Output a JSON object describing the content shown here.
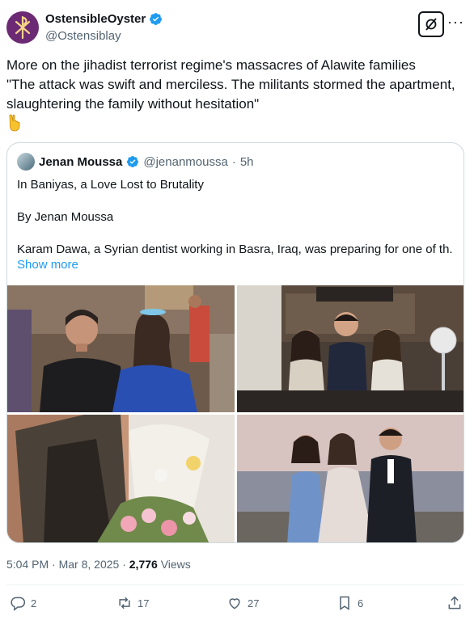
{
  "author": {
    "display_name": "OstensibleOyster",
    "handle": "@Ostensiblay",
    "avatar_icon": "chi-rho-icon",
    "avatar_color": "#6b2a73"
  },
  "post": {
    "text": "More on the jihadist terrorist regime's massacres of Alawite families\n\"The attack was swift and merciless. The militants stormed the apartment, slaughtering the family without hesitation\"",
    "emoji_icon": "pointing-down-icon",
    "time": "5:04 PM",
    "separator": "·",
    "date": "Mar 8, 2025",
    "views_count": "2,776",
    "views_label": "Views"
  },
  "quote": {
    "display_name": "Jenan Moussa",
    "handle": "@jenanmoussa",
    "separator": "·",
    "age": "5h",
    "line1": "In Baniyas, a Love Lost to Brutality",
    "line2": "By Jenan Moussa",
    "line3": "Karam Dawa, a Syrian dentist working in Basra, Iraq, was preparing for one of th...",
    "show_more": "Show more"
  },
  "actions": {
    "replies": "2",
    "reposts": "17",
    "likes": "27",
    "bookmarks": "6"
  },
  "colors": {
    "accent": "#1d9bf0",
    "text": "#0f1419",
    "muted": "#536471",
    "border": "#cfd9de"
  }
}
